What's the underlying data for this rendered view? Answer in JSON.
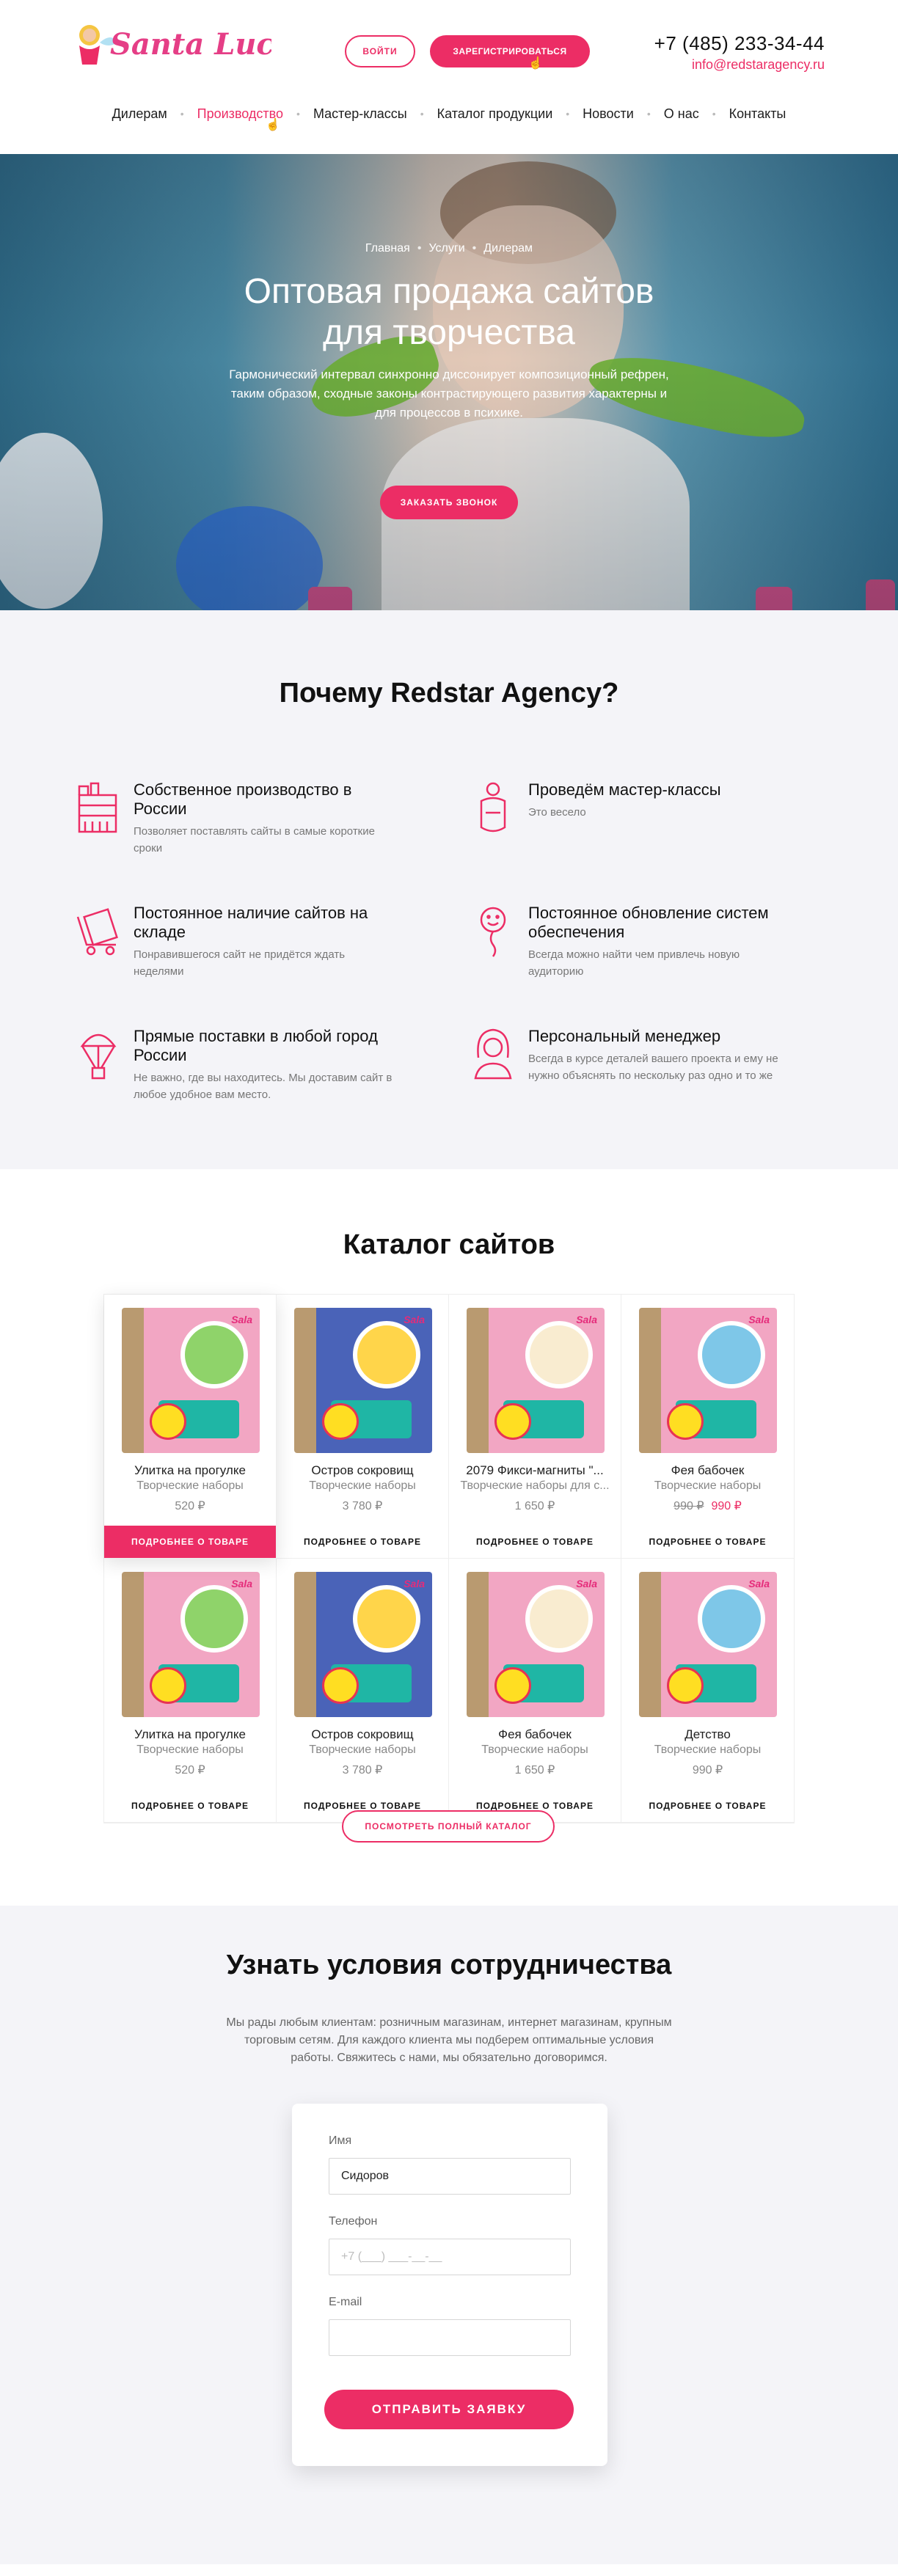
{
  "header": {
    "logo_text": "Santa Lucia",
    "login_label": "ВОЙТИ",
    "register_label": "ЗАРЕГИСТРИРОВАТЬСЯ",
    "phone": "+7 (485) 233-34-44",
    "email": "info@redstaragency.ru",
    "nav": [
      {
        "label": "Дилерам",
        "active": false
      },
      {
        "label": "Производство",
        "active": true
      },
      {
        "label": "Мастер-классы",
        "active": false
      },
      {
        "label": "Каталог продукции",
        "active": false
      },
      {
        "label": "Новости",
        "active": false
      },
      {
        "label": "О нас",
        "active": false
      },
      {
        "label": "Контакты",
        "active": false
      }
    ]
  },
  "hero": {
    "breadcrumb": [
      "Главная",
      "Услуги",
      "Дилерам"
    ],
    "title_line1": "Оптовая продажа сайтов",
    "title_line2": "для творчества",
    "text": "Гармонический интервал синхронно диссонирует композиционный рефрен, таким образом, сходные законы контрастирующего развития характерны и для процессов в психике.",
    "cta_label": "ЗАКАЗАТЬ ЗВОНОК"
  },
  "why": {
    "title": "Почему Redstar Agency?",
    "features": [
      {
        "icon": "factory-icon",
        "title": "Собственное производство в России",
        "desc": "Позволяет поставлять сайты в самые короткие сроки"
      },
      {
        "icon": "apron-icon",
        "title": "Проведём мастер-классы",
        "desc": "Это весело"
      },
      {
        "icon": "warehouse-cart-icon",
        "title": "Постоянное наличие сайтов на складе",
        "desc": "Понравившегося сайт не придётся ждать неделями"
      },
      {
        "icon": "balloon-smile-icon",
        "title": "Постоянное обновление систем обеспечения",
        "desc": "Всегда можно найти чем привлечь новую аудиторию"
      },
      {
        "icon": "parachute-icon",
        "title": "Прямые поставки в любой город России",
        "desc": "Не важно, где вы находитесь. Мы доставим сайт в любое удобное вам место."
      },
      {
        "icon": "manager-icon",
        "title": "Персональный менеджер",
        "desc": "Всегда в курсе деталей вашего проекта и ему не нужно объяснять по нескольку раз одно и то же"
      }
    ]
  },
  "catalog": {
    "title": "Каталог сайтов",
    "more_label": "ПОДРОБНЕЕ О ТОВАРЕ",
    "full_catalog_label": "ПОСМОТРЕТЬ ПОЛНЫЙ КАТАЛОГ",
    "box_brand": "Sala",
    "items": [
      {
        "name": "Улитка на прогулке",
        "category": "Творческие наборы",
        "price": "520 ₽",
        "old_price": "",
        "box_color": "#f2a6c3",
        "circle_color": "#8fd36a",
        "hover": true
      },
      {
        "name": "Остров сокровищ",
        "category": "Творческие наборы",
        "price": "3 780 ₽",
        "old_price": "",
        "box_color": "#4a63b8",
        "circle_color": "#ffd54a",
        "hover": false
      },
      {
        "name": "2079 Фикси-магниты \"...",
        "category": "Творческие наборы для с...",
        "price": "1 650 ₽",
        "old_price": "",
        "box_color": "#f2a6c3",
        "circle_color": "#f9ecd0",
        "hover": false
      },
      {
        "name": "Фея бабочек",
        "category": "Творческие наборы",
        "price": "990 ₽",
        "old_price": "990 ₽",
        "box_color": "#f2a6c3",
        "circle_color": "#7ec7e8",
        "hover": false
      },
      {
        "name": "Улитка на прогулке",
        "category": "Творческие наборы",
        "price": "520 ₽",
        "old_price": "",
        "box_color": "#f2a6c3",
        "circle_color": "#8fd36a",
        "hover": false
      },
      {
        "name": "Остров сокровищ",
        "category": "Творческие наборы",
        "price": "3 780 ₽",
        "old_price": "",
        "box_color": "#4a63b8",
        "circle_color": "#ffd54a",
        "hover": false
      },
      {
        "name": "Фея бабочек",
        "category": "Творческие наборы",
        "price": "1 650 ₽",
        "old_price": "",
        "box_color": "#f2a6c3",
        "circle_color": "#f9ecd0",
        "hover": false
      },
      {
        "name": "Детство",
        "category": "Творческие наборы",
        "price": "990 ₽",
        "old_price": "",
        "box_color": "#f2a6c3",
        "circle_color": "#7ec7e8",
        "hover": false
      }
    ]
  },
  "contact": {
    "title": "Узнать условия сотрудничества",
    "text": "Мы рады любым клиентам: розничным магазинам, интернет магазинам, крупным торговым сетям. Для каждого клиента мы подберем оптимальные условия работы. Свяжитесь с нами, мы обязательно договоримся.",
    "name_label": "Имя",
    "name_value": "Сидоров",
    "phone_label": "Телефон",
    "phone_placeholder": "+7 (___) ___-__-__",
    "email_label": "E-mail",
    "email_value": "",
    "submit_label": "ОТПРАВИТЬ ЗАЯВКУ"
  },
  "colors": {
    "accent": "#ec2d65",
    "section_bg": "#f4f4f8"
  }
}
